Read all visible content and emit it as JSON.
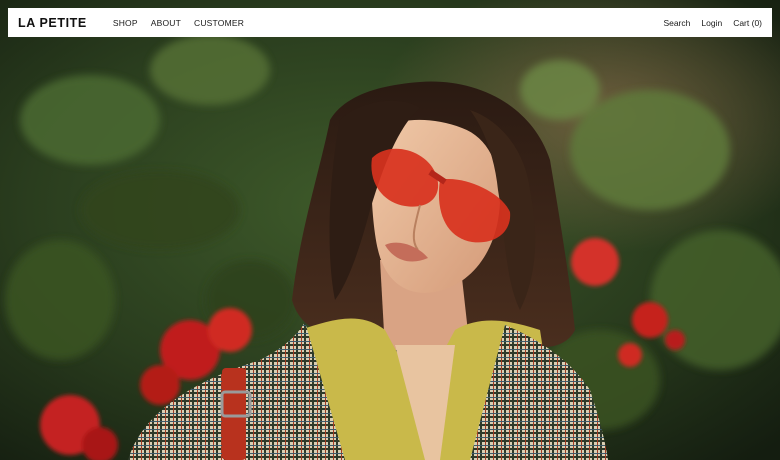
{
  "brand": {
    "logo_text": "LA PETITE"
  },
  "nav": {
    "left": [
      {
        "label": "SHOP"
      },
      {
        "label": "ABOUT"
      },
      {
        "label": "CUSTOMER"
      }
    ],
    "right": [
      {
        "label": "Search"
      },
      {
        "label": "Login"
      },
      {
        "label": "Cart (0)"
      }
    ]
  },
  "hero": {
    "description_icon": "hero-photo",
    "colors": {
      "foliage": "#26381d",
      "flowers": "#c8201e",
      "sunglasses": "#d8321e",
      "shirt": "#c9b94a"
    }
  }
}
